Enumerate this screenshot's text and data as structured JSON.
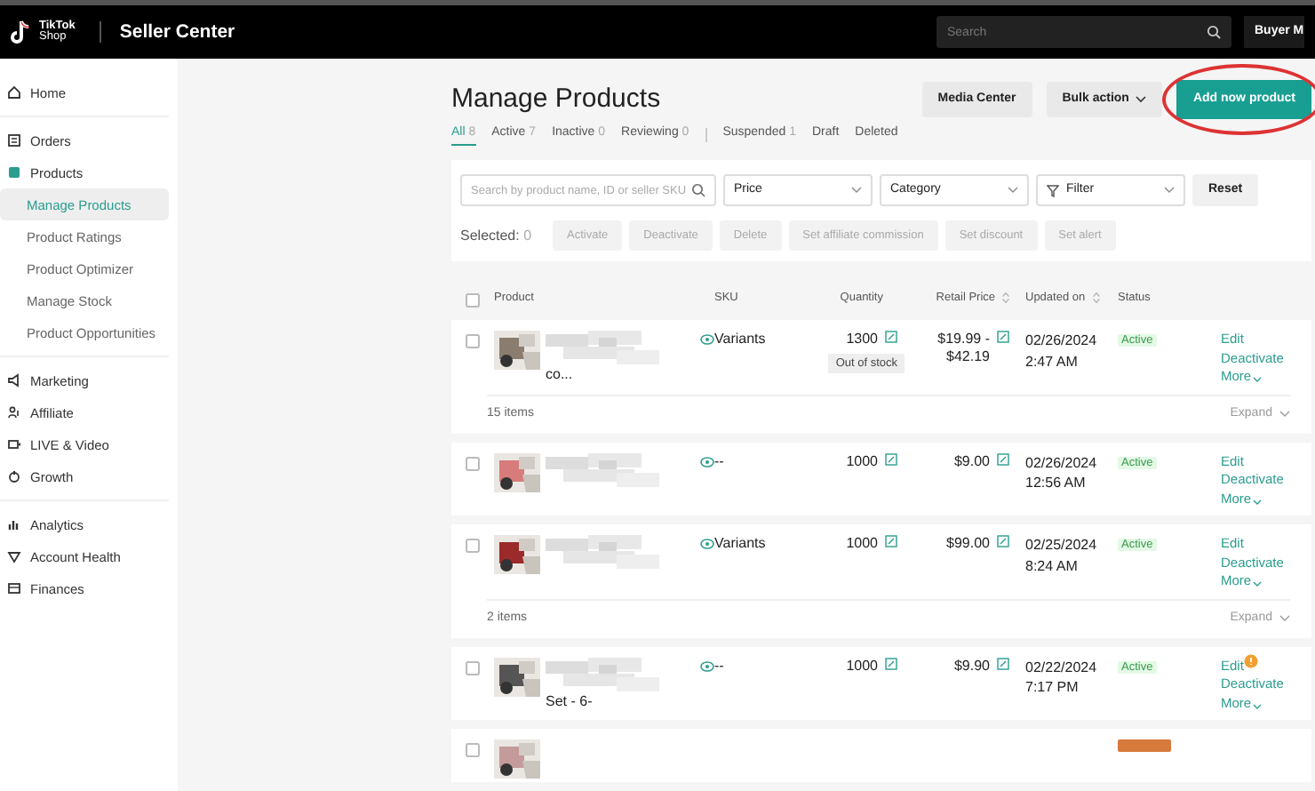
{
  "topbar": {
    "logo_line1": "TikTok",
    "logo_line2": "Shop",
    "title": "Seller Center",
    "search_placeholder": "Search",
    "account": "Buyer M"
  },
  "sidebar": {
    "groups": [
      {
        "items": [
          {
            "label": "Home",
            "selected": false
          }
        ]
      },
      {
        "items": [
          {
            "label": "Orders",
            "selected": false
          },
          {
            "label": "Products",
            "selected": false,
            "active_section": true
          },
          {
            "label": "Manage Products",
            "sub": true,
            "selected": true
          },
          {
            "label": "Product Ratings",
            "sub": true,
            "selected": false
          },
          {
            "label": "Product Optimizer",
            "sub": true,
            "selected": false
          },
          {
            "label": "Manage Stock",
            "sub": true,
            "selected": false
          },
          {
            "label": "Product Opportunities",
            "sub": true,
            "selected": false
          }
        ]
      },
      {
        "items": [
          {
            "label": "Marketing",
            "selected": false
          },
          {
            "label": "Affiliate",
            "selected": false
          },
          {
            "label": "LIVE & Video",
            "selected": false
          },
          {
            "label": "Growth",
            "selected": false
          }
        ]
      },
      {
        "items": [
          {
            "label": "Analytics",
            "selected": false
          },
          {
            "label": "Account Health",
            "selected": false
          },
          {
            "label": "Finances",
            "selected": false
          }
        ]
      }
    ]
  },
  "page": {
    "title": "Manage Products",
    "buttons": [
      {
        "label": "Media Center",
        "kind": "plain",
        "circled": false
      },
      {
        "label": "Bulk action",
        "kind": "dropdown",
        "circled": false
      },
      {
        "label": "Add now product",
        "kind": "primary",
        "circled": true
      }
    ],
    "tabs": [
      {
        "label": "All",
        "count": "8",
        "selected": true
      },
      {
        "label": "Active",
        "count": "7",
        "selected": false
      },
      {
        "label": "Inactive",
        "count": "0",
        "selected": false
      },
      {
        "label": "Reviewing",
        "count": "0",
        "selected": false,
        "divider_after": true
      },
      {
        "label": "Suspended",
        "count": "1",
        "selected": false
      },
      {
        "label": "Draft",
        "selected": false
      },
      {
        "label": "Deleted",
        "selected": false
      }
    ],
    "filters": {
      "search_placeholder": "Search by product name, ID or seller SKU",
      "selects": [
        {
          "label": "Price",
          "kind": "select"
        },
        {
          "label": "Category",
          "kind": "select"
        },
        {
          "label": "Filter",
          "kind": "filter"
        }
      ],
      "reset": "Reset"
    },
    "selection": {
      "label": "Selected:",
      "count": "0",
      "actions": [
        {
          "label": "Activate",
          "disabled": true
        },
        {
          "label": "Deactivate",
          "disabled": true
        },
        {
          "label": "Delete",
          "disabled": true
        },
        {
          "label": "Set affiliate commission",
          "disabled": true
        },
        {
          "label": "Set discount",
          "disabled": true
        },
        {
          "label": "Set alert",
          "disabled": true
        }
      ]
    },
    "table": {
      "columns": [
        {
          "label": "Product"
        },
        {
          "label": "SKU"
        },
        {
          "label": "Quantity"
        },
        {
          "label": "Retail Price",
          "sortable": true
        },
        {
          "label": "Updated on",
          "sortable": true
        },
        {
          "label": "Status"
        }
      ],
      "header_checked": false,
      "rows": [
        {
          "checked": false,
          "name_fragment": "co...",
          "sku": "Variants",
          "quantity": "1300",
          "stock_badge": "Out of stock",
          "price": "$19.99 - $42.19",
          "date": "02/26/2024",
          "time": "2:47 AM",
          "status": "Active",
          "color": "#3c9a4c",
          "actions": [
            "Edit",
            "Deactivate",
            "More"
          ],
          "edit_alert": false,
          "footer": {
            "items": "15 items",
            "expand": "Expand"
          }
        },
        {
          "checked": false,
          "sku": "--",
          "quantity": "1000",
          "price": "$9.00",
          "date": "02/26/2024",
          "time": "12:56 AM",
          "status": "Active",
          "color": "#3c9a4c",
          "actions": [
            "Edit",
            "Deactivate",
            "More"
          ],
          "edit_alert": false
        },
        {
          "checked": false,
          "sku": "Variants",
          "quantity": "1000",
          "price": "$99.00",
          "date": "02/25/2024",
          "time": "8:24 AM",
          "status": "Active",
          "color": "#3c9a4c",
          "actions": [
            "Edit",
            "Deactivate",
            "More"
          ],
          "edit_alert": false,
          "footer": {
            "items": "2 items",
            "expand": "Expand"
          }
        },
        {
          "checked": false,
          "name_fragment": "Set - 6-",
          "sku": "--",
          "quantity": "1000",
          "price": "$9.90",
          "date": "02/22/2024",
          "time": "7:17 PM",
          "status": "Active",
          "color": "#3c9a4c",
          "actions": [
            "Edit",
            "Deactivate",
            "More"
          ],
          "edit_alert": true
        },
        {
          "checked": false,
          "partial": true,
          "color": "#d67a3c"
        }
      ]
    }
  }
}
